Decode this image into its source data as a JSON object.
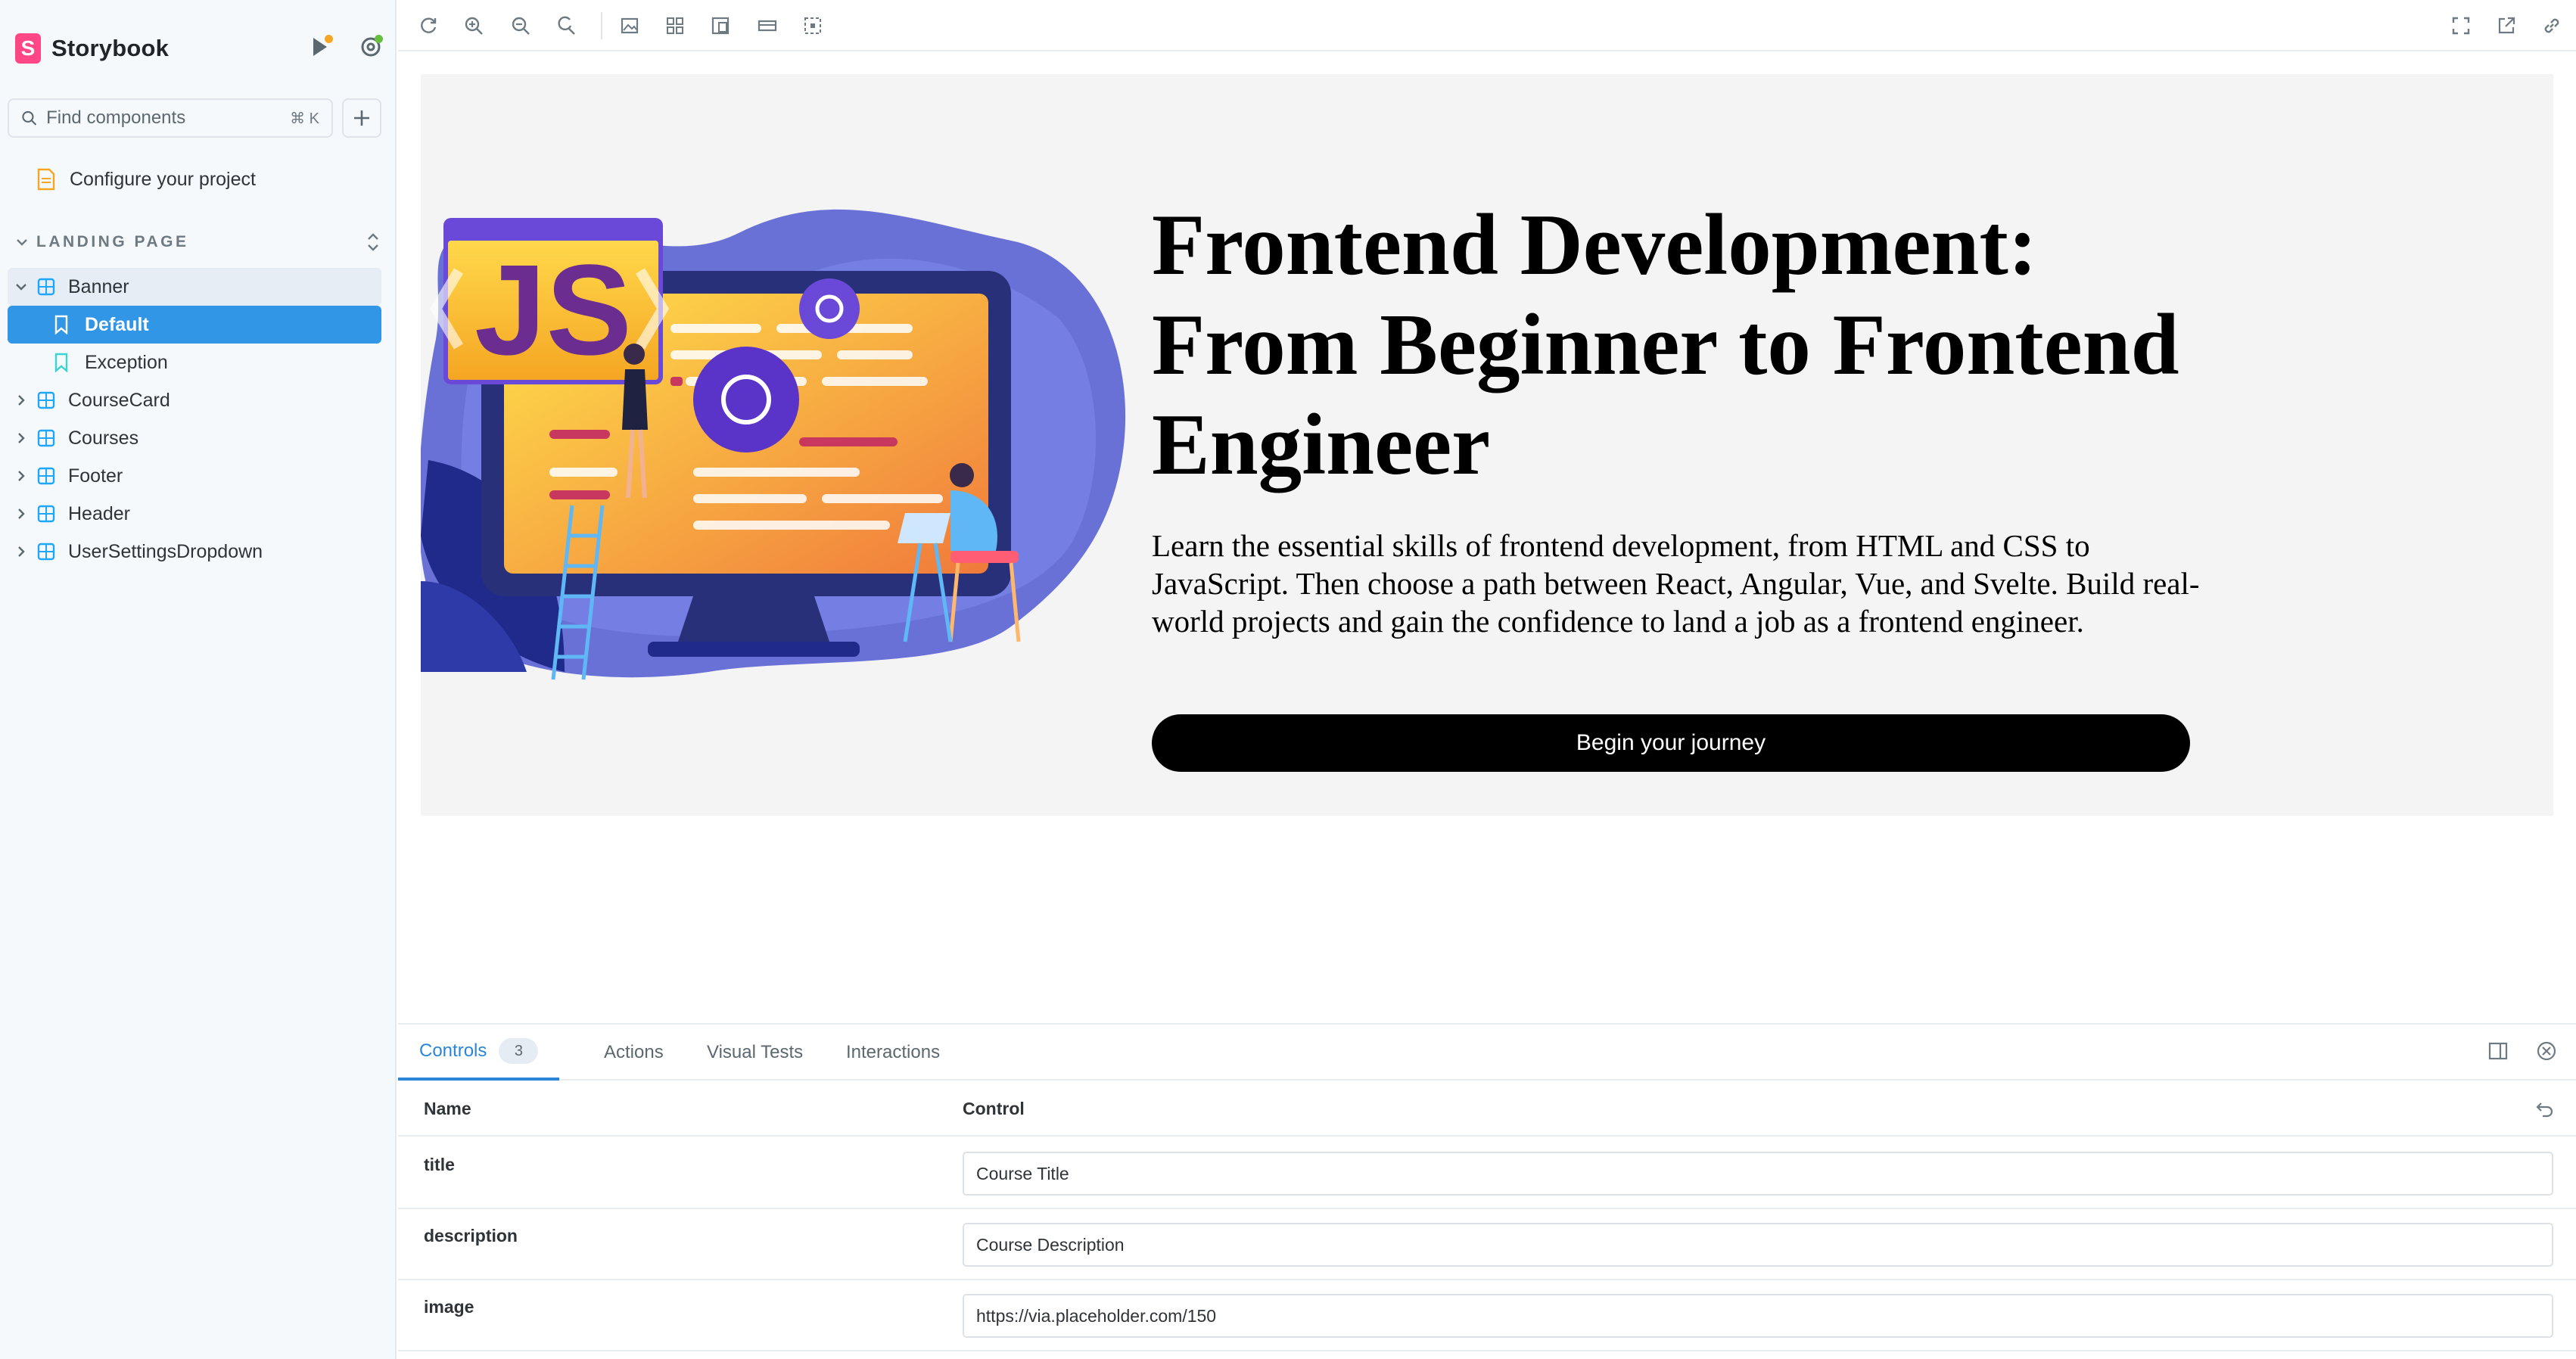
{
  "app": {
    "brand": "Storybook",
    "brand_letter": "S"
  },
  "sidebar": {
    "search_placeholder": "Find components",
    "search_shortcut": "⌘ K",
    "configure_label": "Configure your project",
    "section_title": "LANDING PAGE",
    "items": [
      {
        "label": "Banner"
      },
      {
        "label": "Default"
      },
      {
        "label": "Exception"
      },
      {
        "label": "CourseCard"
      },
      {
        "label": "Courses"
      },
      {
        "label": "Footer"
      },
      {
        "label": "Header"
      },
      {
        "label": "UserSettingsDropdown"
      }
    ]
  },
  "banner": {
    "title": "Frontend Development: From Beginner to Frontend Engineer",
    "description": "Learn the essential skills of frontend development, from HTML and CSS to JavaScript. Then choose a path between React, Angular, Vue, and Svelte. Build real-world projects and gain the confidence to land a job as a frontend engineer.",
    "button_label": "Begin your journey",
    "illustration_text": "JS"
  },
  "panel": {
    "tabs": [
      {
        "label": "Controls",
        "badge": "3"
      },
      {
        "label": "Actions"
      },
      {
        "label": "Visual Tests"
      },
      {
        "label": "Interactions"
      }
    ],
    "columns": {
      "name": "Name",
      "control": "Control"
    },
    "controls": [
      {
        "name": "title",
        "value": "Course Title"
      },
      {
        "name": "description",
        "value": "Course Description"
      },
      {
        "name": "image",
        "value": "https://via.placeholder.com/150"
      }
    ]
  },
  "colors": {
    "accent": "#3296e6",
    "brand": "#ff4785",
    "sidebar_bg": "#f6f9fc",
    "banner_bg": "#f4f4f4"
  }
}
